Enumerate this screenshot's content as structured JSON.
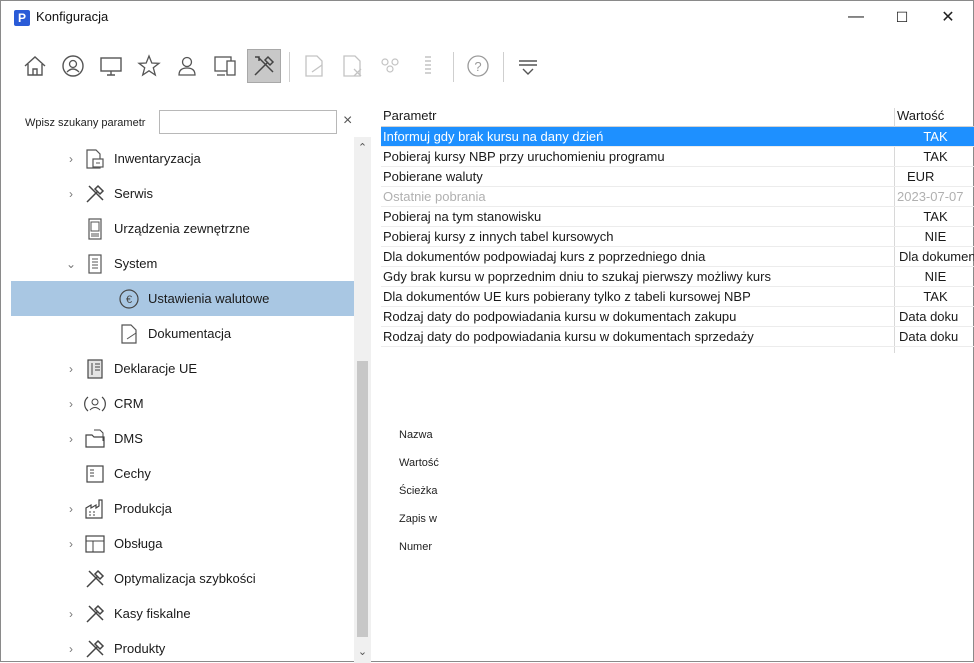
{
  "window": {
    "title": "Konfiguracja",
    "app_icon_letter": "P",
    "minimize": "—",
    "maximize": "☐",
    "close": "✕"
  },
  "search": {
    "label": "Wpisz szukany parametr",
    "value": "",
    "placeholder": "",
    "clear": "×"
  },
  "tree": {
    "items": [
      {
        "label": "Inwentaryzacja",
        "icon": "inventory-icon",
        "expander": "›"
      },
      {
        "label": "Serwis",
        "icon": "tools-icon",
        "expander": "›"
      },
      {
        "label": "Urządzenia zewnętrzne",
        "icon": "device-icon",
        "expander": ""
      },
      {
        "label": "System",
        "icon": "document-icon",
        "expander": "⌄"
      },
      {
        "label": "Ustawienia walutowe",
        "icon": "euro-icon",
        "expander": ""
      },
      {
        "label": "Dokumentacja",
        "icon": "page-icon",
        "expander": ""
      },
      {
        "label": "Deklaracje UE",
        "icon": "binder-icon",
        "expander": "›"
      },
      {
        "label": "CRM",
        "icon": "crm-icon",
        "expander": "›"
      },
      {
        "label": "DMS",
        "icon": "folder-doc-icon",
        "expander": "›"
      },
      {
        "label": "Cechy",
        "icon": "list-icon",
        "expander": ""
      },
      {
        "label": "Produkcja",
        "icon": "factory-icon",
        "expander": "›"
      },
      {
        "label": "Obsługa",
        "icon": "layout-icon",
        "expander": "›"
      },
      {
        "label": "Optymalizacja szybkości",
        "icon": "tools-icon",
        "expander": ""
      },
      {
        "label": "Kasy fiskalne",
        "icon": "tools-icon",
        "expander": "›"
      },
      {
        "label": "Produkty",
        "icon": "tools-icon",
        "expander": "›"
      }
    ]
  },
  "grid": {
    "header": {
      "param": "Parametr",
      "value": "Wartość"
    },
    "rows": [
      {
        "param": "Informuj gdy brak kursu na dany dzień",
        "value": "TAK"
      },
      {
        "param": "Pobieraj kursy NBP przy uruchomieniu programu",
        "value": "TAK"
      },
      {
        "param": "Pobierane waluty",
        "value": "EUR"
      },
      {
        "param": "Ostatnie pobrania",
        "value": "2023-07-07"
      },
      {
        "param": "Pobieraj na tym stanowisku",
        "value": "TAK"
      },
      {
        "param": "Pobieraj kursy z innych tabel kursowych",
        "value": "NIE"
      },
      {
        "param": "Dla dokumentów podpowiadaj kurs z poprzedniego dnia",
        "value": "Dla dokumen"
      },
      {
        "param": "Gdy brak kursu w poprzednim dniu to szukaj pierwszy możliwy kurs",
        "value": "NIE"
      },
      {
        "param": "Dla dokumentów UE kurs pobierany tylko z tabeli kursowej NBP",
        "value": "TAK"
      },
      {
        "param": "Rodzaj daty do podpowiadania kursu w dokumentach zakupu",
        "value": "Data doku"
      },
      {
        "param": "Rodzaj daty do podpowiadania kursu w dokumentach sprzedaży",
        "value": "Data doku"
      }
    ]
  },
  "details": {
    "labels": [
      "Nazwa",
      "Wartość",
      "Ścieżka",
      "Zapis w",
      "Numer"
    ]
  },
  "colors": {
    "tree_selected": "#a9c7e3",
    "grid_selected": "#1e90ff",
    "dim_text": "#b0b0b0"
  }
}
